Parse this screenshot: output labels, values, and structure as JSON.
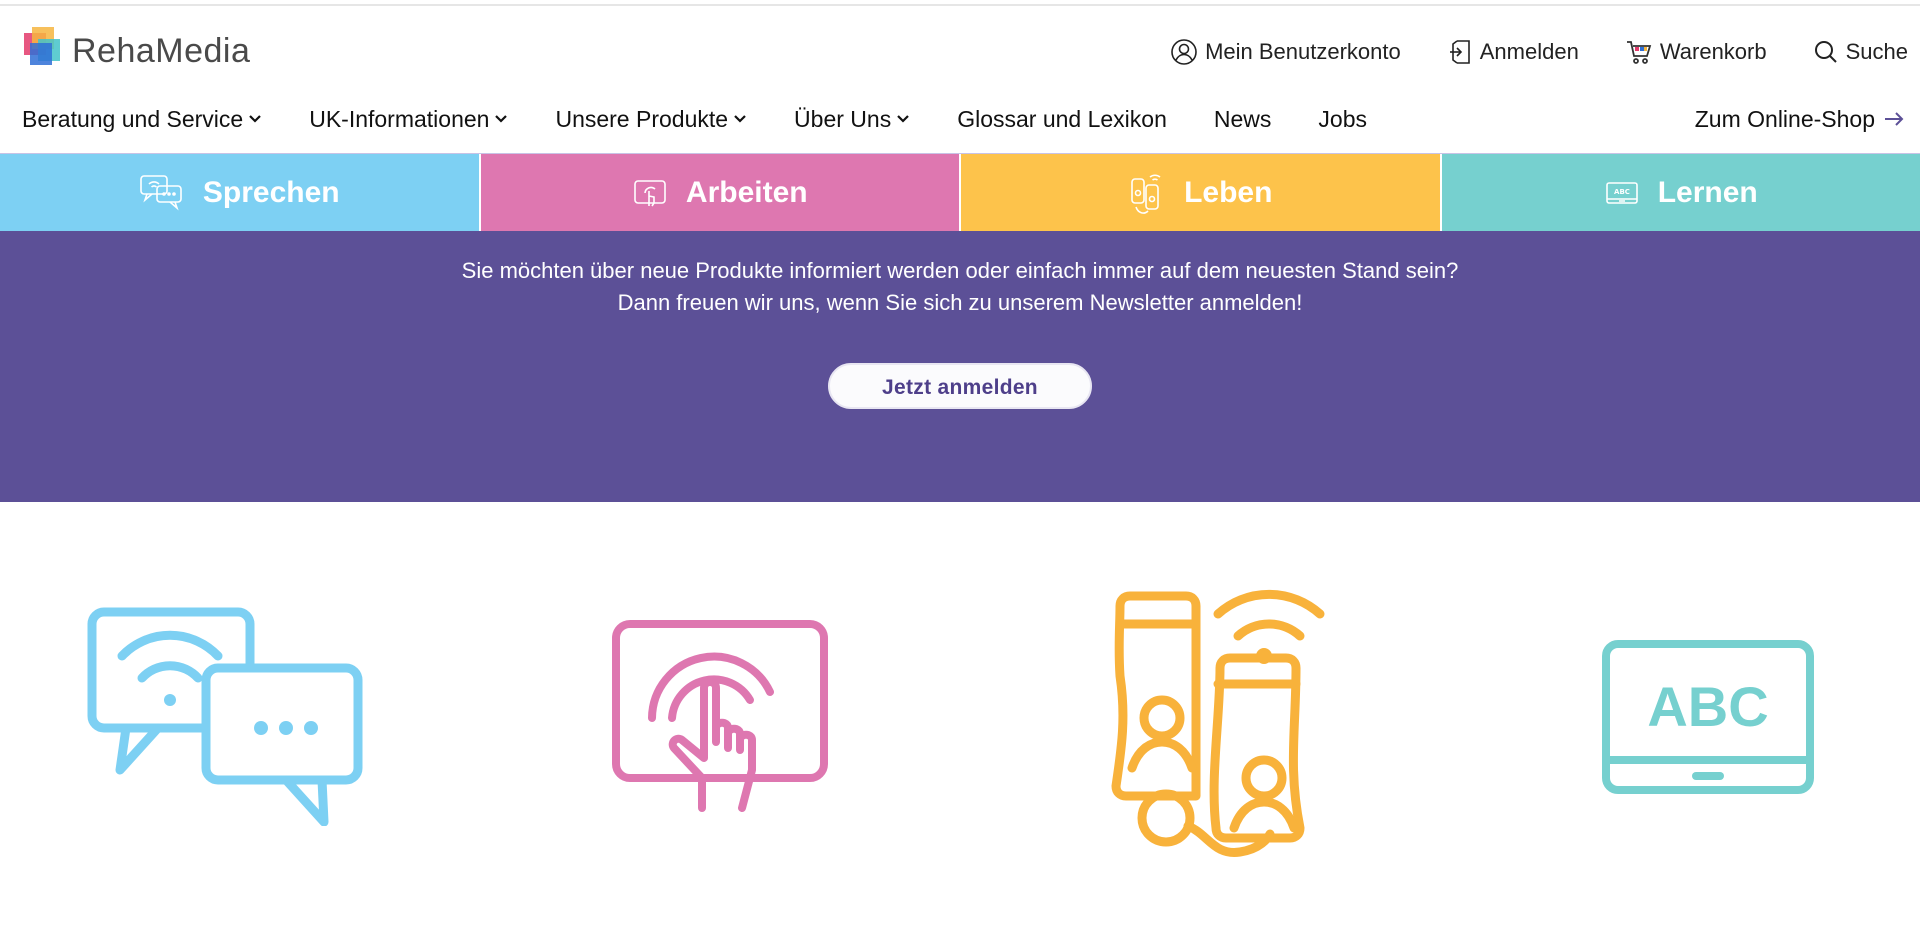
{
  "brand": {
    "name": "RehaMedia",
    "logo_colors": [
      "#e33a6b",
      "#2f6fd6",
      "#f6b53f",
      "#43c3c9"
    ]
  },
  "utility_nav": [
    {
      "label": "Mein Benutzerkonto",
      "icon": "user-circle-icon"
    },
    {
      "label": "Anmelden",
      "icon": "login-door-icon"
    },
    {
      "label": "Warenkorb",
      "icon": "cart-icon"
    },
    {
      "label": "Suche",
      "icon": "search-icon"
    }
  ],
  "main_nav": [
    {
      "label": "Beratung und Service",
      "has_dropdown": true
    },
    {
      "label": "UK-Informationen",
      "has_dropdown": true
    },
    {
      "label": "Unsere Produkte",
      "has_dropdown": true
    },
    {
      "label": "Über Uns",
      "has_dropdown": true
    },
    {
      "label": "Glossar und Lexikon",
      "has_dropdown": false
    },
    {
      "label": "News",
      "has_dropdown": false
    },
    {
      "label": "Jobs",
      "has_dropdown": false
    }
  ],
  "shop_link": {
    "label": "Zum Online-Shop",
    "icon": "arrow-right-icon",
    "arrow_color": "#5c5097"
  },
  "categories": [
    {
      "label": "Sprechen",
      "color": "#7dd0f3",
      "icon": "speech-bubbles-icon"
    },
    {
      "label": "Arbeiten",
      "color": "#de77b0",
      "icon": "touch-screen-icon"
    },
    {
      "label": "Leben",
      "color": "#fdc34b",
      "icon": "devices-icon"
    },
    {
      "label": "Lernen",
      "color": "#76d0cf",
      "icon": "abc-tablet-icon"
    }
  ],
  "newsletter": {
    "line1": "Sie möchten über neue Produkte informiert werden oder einfach immer auf dem neuesten Stand sein?",
    "line2": "Dann freuen wir uns, wenn Sie sich zu unserem Newsletter anmelden!",
    "button_label": "Jetzt anmelden",
    "background": "#5c5097"
  },
  "feature_icons": [
    {
      "name": "speech-bubbles-wifi-icon",
      "color": "#7dd0f3"
    },
    {
      "name": "touch-screen-icon",
      "color": "#de77b0"
    },
    {
      "name": "communication-devices-icon",
      "color": "#f8b23b"
    },
    {
      "name": "abc-tablet-icon",
      "color": "#76d0cf",
      "text": "ABC"
    }
  ]
}
